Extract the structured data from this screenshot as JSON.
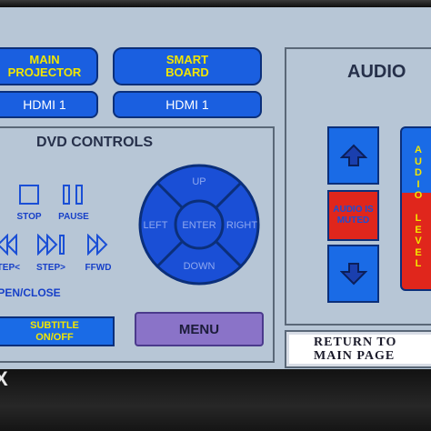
{
  "sources": {
    "main_projector": {
      "line1": "MAIN",
      "line2": "PROJECTOR",
      "input": "HDMI 1"
    },
    "smart_board": {
      "line1": "SMART",
      "line2": "BOARD",
      "input": "HDMI 1"
    }
  },
  "dvd": {
    "title": "DVD CONTROLS",
    "stop_label": "STOP",
    "pause_label": "PAUSE",
    "step_back_label": "STEP<",
    "step_fwd_label": "STEP>",
    "ffwd_label": "FFWD",
    "open_close_label": "OPEN/CLOSE",
    "subtitle_line1": "SUBTITLE",
    "subtitle_line2": "ON/OFF",
    "menu_label": "MENU",
    "dpad": {
      "up": "UP",
      "down": "DOWN",
      "left": "LEFT",
      "right": "RIGHT",
      "enter": "ENTER"
    }
  },
  "audio": {
    "title": "AUDIO",
    "muted_line1": "AUDIO IS",
    "muted_line2": "MUTED",
    "level_label": [
      "A",
      "U",
      "D",
      "I",
      "O",
      "",
      "L",
      "E",
      "V",
      "E",
      "L"
    ]
  },
  "return_button": {
    "line1": "RETURN TO",
    "line2": "MAIN PAGE"
  },
  "logo_text": "X",
  "colors": {
    "accent": "#1a5fe0",
    "screen": "#b7c6d6",
    "label_blue": "#1740c8",
    "muted_red": "#e0261c",
    "menu_purple": "#8a73c8"
  }
}
